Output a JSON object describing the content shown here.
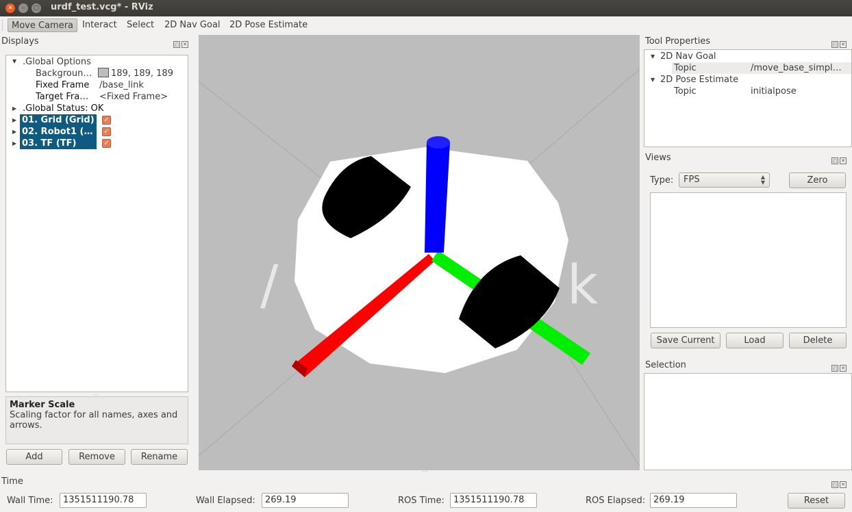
{
  "window": {
    "title": "urdf_test.vcg* - RViz"
  },
  "toolbar": {
    "tools": [
      "Move Camera",
      "Interact",
      "Select",
      "2D Nav Goal",
      "2D Pose Estimate"
    ]
  },
  "displays": {
    "title": "Displays",
    "global_options": ".Global Options",
    "background_label": "Backgroun…",
    "background_value": "189, 189, 189",
    "fixed_frame_label": "Fixed Frame",
    "fixed_frame_value": "/base_link",
    "target_frame_label": "Target Fra…",
    "target_frame_value": "<Fixed Frame>",
    "global_status": ".Global Status: OK",
    "items": [
      "01. Grid (Grid)",
      "02. Robot1 (…",
      "03. TF (TF)"
    ],
    "info_title": "Marker Scale",
    "info_text": "Scaling factor for all names, axes and arrows.",
    "add": "Add",
    "remove": "Remove",
    "rename": "Rename"
  },
  "viewport": {
    "overlay_text_left": "/",
    "overlay_text_right": "k",
    "colors": {
      "background": "#bdbdbd",
      "x_axis": "#ff0000",
      "y_axis": "#00ff00",
      "z_axis": "#0000ff",
      "wheel": "#000000",
      "base": "#ffffff"
    }
  },
  "tool_properties": {
    "title": "Tool Properties",
    "nav_goal": "2D Nav Goal",
    "nav_topic_label": "Topic",
    "nav_topic_value": "/move_base_simpl…",
    "pose_estimate": "2D Pose Estimate",
    "pose_topic_label": "Topic",
    "pose_topic_value": "initialpose"
  },
  "views": {
    "title": "Views",
    "type_label": "Type:",
    "type_value": "FPS",
    "zero": "Zero",
    "save_current": "Save Current",
    "load": "Load",
    "delete": "Delete"
  },
  "selection": {
    "title": "Selection"
  },
  "time": {
    "title": "Time",
    "wall_time_label": "Wall Time:",
    "wall_time_value": "1351511190.78",
    "wall_elapsed_label": "Wall Elapsed:",
    "wall_elapsed_value": "269.19",
    "ros_time_label": "ROS Time:",
    "ros_time_value": "1351511190.78",
    "ros_elapsed_label": "ROS Elapsed:",
    "ros_elapsed_value": "269.19",
    "reset": "Reset"
  }
}
